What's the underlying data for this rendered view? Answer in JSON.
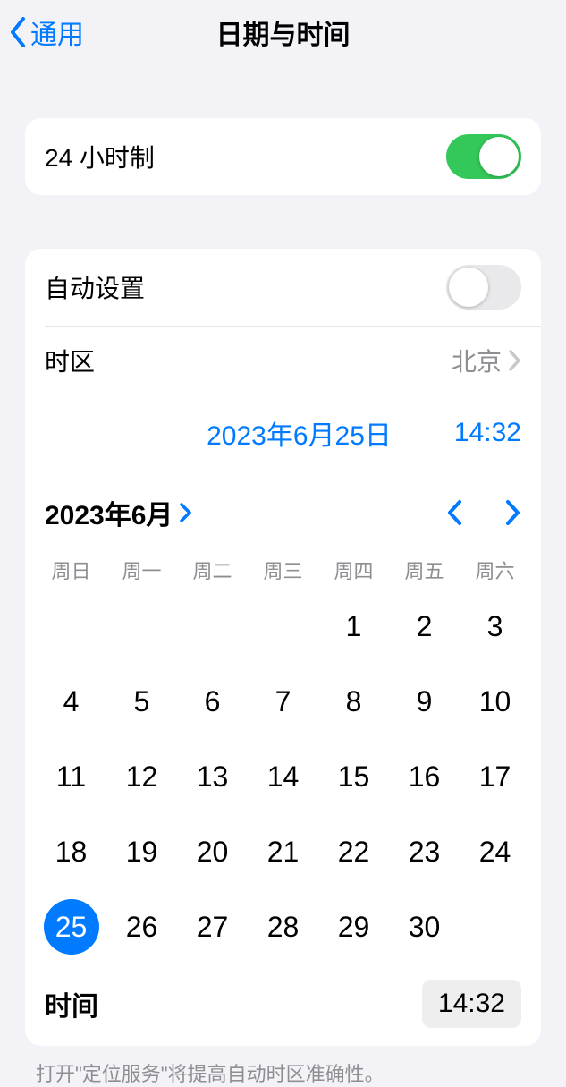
{
  "nav": {
    "back_label": "通用",
    "title": "日期与时间"
  },
  "section1": {
    "clock24_label": "24 小时制",
    "clock24_on": true
  },
  "section2": {
    "auto_label": "自动设置",
    "auto_on": false,
    "timezone_label": "时区",
    "timezone_value": "北京"
  },
  "datetime": {
    "date_display": "2023年6月25日",
    "time_display": "14:32"
  },
  "calendar": {
    "month_label": "2023年6月",
    "weekdays": [
      "周日",
      "周一",
      "周二",
      "周三",
      "周四",
      "周五",
      "周六"
    ],
    "leading_blanks": 4,
    "days_in_month": 30,
    "selected_day": 25
  },
  "time_row": {
    "label": "时间",
    "value": "14:32"
  },
  "footer": "打开\"定位服务\"将提高自动时区准确性。"
}
